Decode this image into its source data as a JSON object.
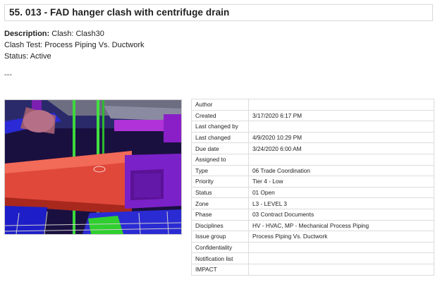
{
  "title": "55. 013 - FAD hanger clash with centrifuge drain",
  "description": {
    "label": "Description:",
    "value": "Clash: Clash30"
  },
  "clash_test": "Clash Test: Process Piping Vs. Ductwork",
  "status_line": "Status: Active",
  "separator": "---",
  "image": {
    "icon": "clash-3d-view"
  },
  "properties": [
    {
      "label": "Author",
      "value": ""
    },
    {
      "label": "Created",
      "value": "3/17/2020 6:17 PM"
    },
    {
      "label": "Last changed by",
      "value": ""
    },
    {
      "label": "Last changed",
      "value": "4/9/2020 10:29 PM"
    },
    {
      "label": "Due date",
      "value": "3/24/2020 6:00 AM"
    },
    {
      "label": "Assigned to",
      "value": ""
    },
    {
      "label": "Type",
      "value": "06 Trade Coordination"
    },
    {
      "label": "Priority",
      "value": "Tier 4 - Low"
    },
    {
      "label": "Status",
      "value": "01 Open"
    },
    {
      "label": "Zone",
      "value": "L3 - LEVEL 3"
    },
    {
      "label": "Phase",
      "value": "03 Contract Documents"
    },
    {
      "label": "Disciplines",
      "value": "HV - HVAC, MP - Mechanical Process Piping"
    },
    {
      "label": "Issue group",
      "value": "Process Piping Vs. Ductwork"
    },
    {
      "label": "Confidentiality",
      "value": ""
    },
    {
      "label": "Notification list",
      "value": ""
    },
    {
      "label": "IMPACT",
      "value": ""
    }
  ]
}
